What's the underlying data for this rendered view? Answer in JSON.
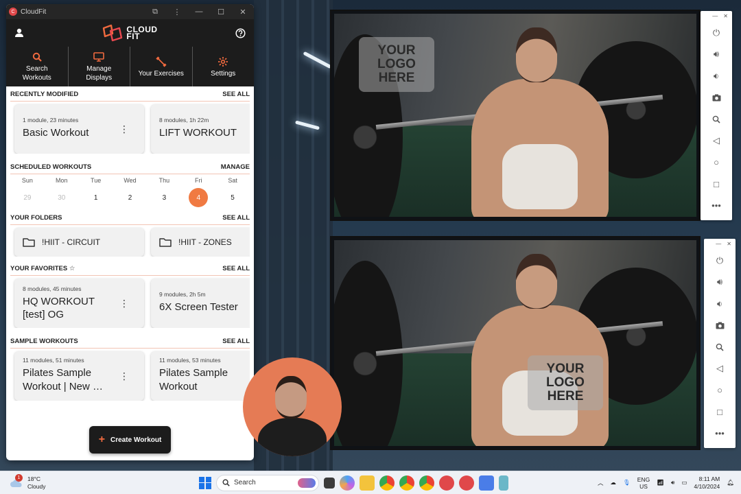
{
  "window": {
    "title": "CloudFit"
  },
  "brand": {
    "logo_line1": "CLOUD",
    "logo_line2": "FIT",
    "accent": "#f06a3f"
  },
  "nav": {
    "items": [
      {
        "label": "Search Workouts",
        "icon": "search-icon"
      },
      {
        "label": "Manage Displays",
        "icon": "monitor-icon"
      },
      {
        "label": "Your Exercises",
        "icon": "dumbbell-icon"
      },
      {
        "label": "Settings",
        "icon": "gear-icon"
      }
    ]
  },
  "recent": {
    "heading": "RECENTLY MODIFIED",
    "see_all": "SEE ALL",
    "cards": [
      {
        "meta": "1 module, 23 minutes",
        "name": "Basic Workout"
      },
      {
        "meta": "8 modules, 1h 22m",
        "name": "LIFT WORKOUT"
      }
    ]
  },
  "scheduled": {
    "heading": "SCHEDULED WORKOUTS",
    "manage": "MANAGE",
    "days": [
      {
        "dow": "Sun",
        "num": "29"
      },
      {
        "dow": "Mon",
        "num": "30"
      },
      {
        "dow": "Tue",
        "num": "1"
      },
      {
        "dow": "Wed",
        "num": "2"
      },
      {
        "dow": "Thu",
        "num": "3"
      },
      {
        "dow": "Fri",
        "num": "4"
      },
      {
        "dow": "Sat",
        "num": "5"
      }
    ]
  },
  "folders": {
    "heading": "YOUR FOLDERS",
    "see_all": "SEE ALL",
    "items": [
      {
        "name": "!HIIT - CIRCUIT"
      },
      {
        "name": "!HIIT - ZONES"
      }
    ]
  },
  "favorites": {
    "heading": "YOUR FAVORITES",
    "see_all": "SEE ALL",
    "cards": [
      {
        "meta": "8 modules, 45 minutes",
        "name_line1": "HQ WORKOUT",
        "name_line2": "[test] OG"
      },
      {
        "meta": "9 modules, 2h 5m",
        "name_line1": "6X Screen Tester",
        "name_line2": ""
      }
    ]
  },
  "samples": {
    "heading": "SAMPLE WORKOUTS",
    "see_all": "SEE ALL",
    "cards": [
      {
        "meta": "11 modules, 51 minutes",
        "name_line1": "Pilates Sample",
        "name_line2": "Workout | New …"
      },
      {
        "meta": "11 modules, 53 minutes",
        "name_line1": "Pilates Sample",
        "name_line2": "Workout"
      }
    ]
  },
  "fab": {
    "label": "Create Workout"
  },
  "displays": {
    "logo_line1": "YOUR",
    "logo_line2": "LOGO",
    "logo_line3": "HERE"
  },
  "taskbar": {
    "weather_temp": "18°C",
    "weather_desc": "Cloudy",
    "weather_badge": "1",
    "search_placeholder": "Search",
    "lang_line1": "ENG",
    "lang_line2": "US",
    "time": "8:11 AM",
    "date": "4/10/2024"
  }
}
